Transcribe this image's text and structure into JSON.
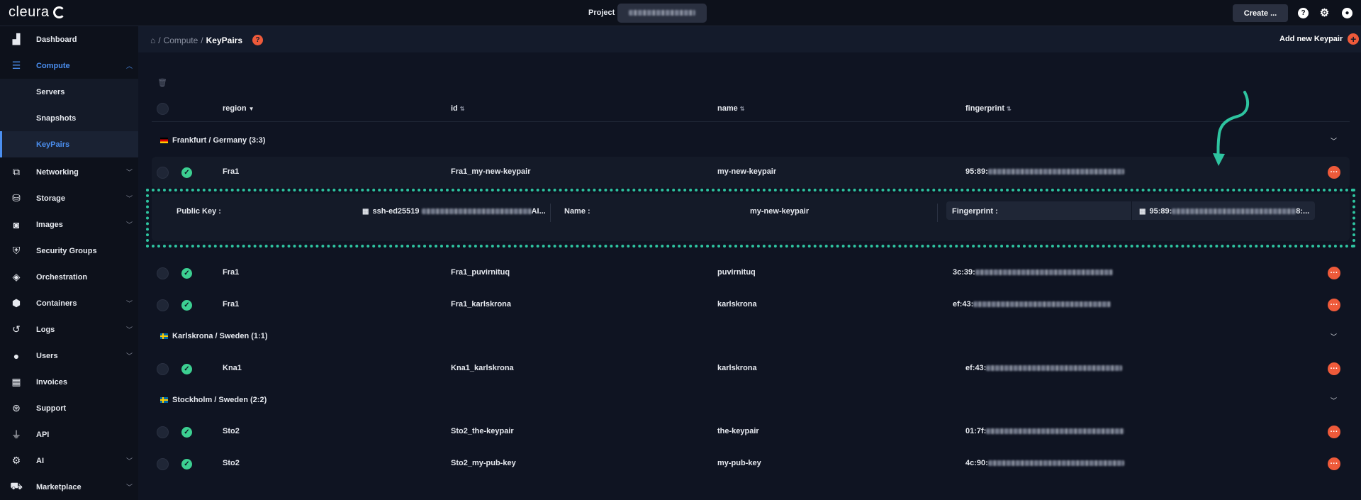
{
  "topbar": {
    "logo_text": "cleura",
    "project_label": "Project",
    "create_label": "Create ..."
  },
  "sidebar": {
    "items": [
      {
        "label": "Dashboard",
        "icon": "chart-icon"
      },
      {
        "label": "Compute",
        "icon": "server-icon"
      },
      {
        "label": "Networking",
        "icon": "network-icon"
      },
      {
        "label": "Storage",
        "icon": "database-icon"
      },
      {
        "label": "Images",
        "icon": "camera-icon"
      },
      {
        "label": "Security Groups",
        "icon": "shield-icon"
      },
      {
        "label": "Orchestration",
        "icon": "orchestration-icon"
      },
      {
        "label": "Containers",
        "icon": "box-icon"
      },
      {
        "label": "Logs",
        "icon": "history-icon"
      },
      {
        "label": "Users",
        "icon": "user-icon"
      },
      {
        "label": "Invoices",
        "icon": "calculator-icon"
      },
      {
        "label": "Support",
        "icon": "lifebuoy-icon"
      },
      {
        "label": "API",
        "icon": "plug-icon"
      },
      {
        "label": "AI",
        "icon": "gear-icon"
      },
      {
        "label": "Marketplace",
        "icon": "cart-icon"
      }
    ],
    "compute_sub": [
      "Servers",
      "Snapshots",
      "KeyPairs"
    ]
  },
  "header": {
    "breadcrumb": [
      "Compute",
      "KeyPairs"
    ],
    "add_label": "Add new Keypair"
  },
  "table": {
    "columns": [
      "region",
      "id",
      "name",
      "fingerprint"
    ],
    "groups": [
      {
        "label": "Frankfurt / Germany (3:3)",
        "rows": [
          {
            "region": "Fra1",
            "id": "Fra1_my-new-keypair",
            "name": "my-new-keypair",
            "fingerprint": "95:89:"
          },
          {
            "region": "Fra1",
            "id": "Fra1_puvirnituq",
            "name": "puvirnituq",
            "fingerprint": "3c:39:"
          },
          {
            "region": "Fra1",
            "id": "Fra1_karlskrona",
            "name": "karlskrona",
            "fingerprint": "ef:43:"
          }
        ]
      },
      {
        "label": "Karlskrona / Sweden (1:1)",
        "rows": [
          {
            "region": "Kna1",
            "id": "Kna1_karlskrona",
            "name": "karlskrona",
            "fingerprint": "ef:43:"
          }
        ]
      },
      {
        "label": "Stockholm / Sweden (2:2)",
        "rows": [
          {
            "region": "Sto2",
            "id": "Sto2_the-keypair",
            "name": "the-keypair",
            "fingerprint": "01:7f:"
          },
          {
            "region": "Sto2",
            "id": "Sto2_my-pub-key",
            "name": "my-pub-key",
            "fingerprint": "4c:90:"
          }
        ]
      }
    ]
  },
  "detail": {
    "public_key_label": "Public Key :",
    "public_key_value": "ssh-ed25519",
    "public_key_suffix": "AI...",
    "name_label": "Name :",
    "name_value": "my-new-keypair",
    "fingerprint_label": "Fingerprint :",
    "fingerprint_value": "95:89:",
    "fingerprint_suffix": "8:..."
  },
  "colors": {
    "accent": "#4b8ff0",
    "action": "#ee5a3a",
    "success": "#3ccf91",
    "highlight": "#2ec4a0"
  }
}
